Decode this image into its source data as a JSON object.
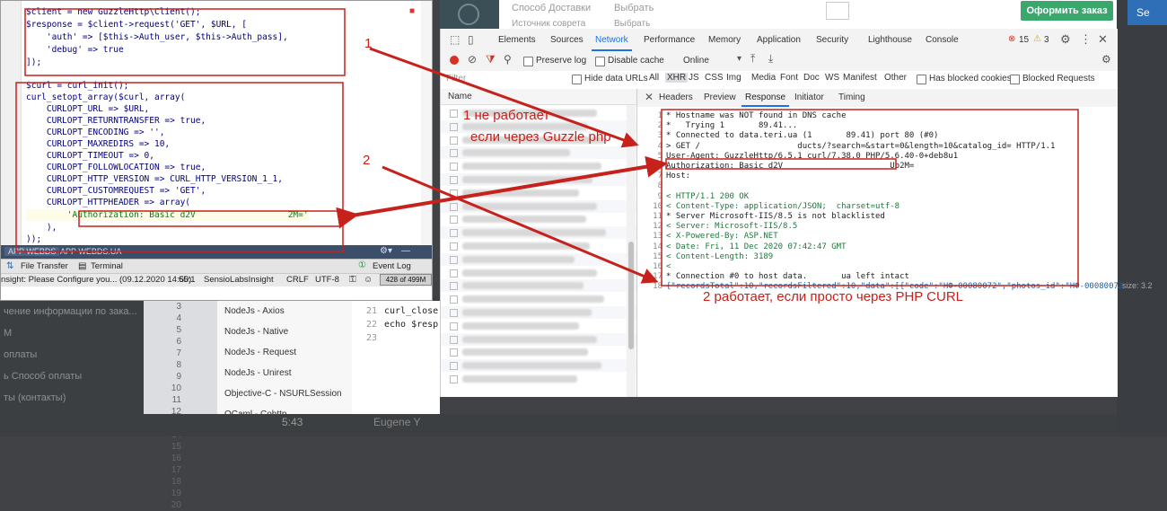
{
  "background": {
    "menu_items": [
      "чение информации по зака...",
      "M",
      "оплаты",
      "ь Способ оплаты",
      "ты (контакты)"
    ],
    "gutter_numbers": [
      "3",
      "4",
      "5",
      "6",
      "7",
      "8",
      "9",
      "10",
      "11",
      "12",
      "13",
      "14",
      "15",
      "16",
      "17",
      "18",
      "19",
      "20"
    ],
    "list_items": [
      "NodeJs - Axios",
      "NodeJs - Native",
      "NodeJs - Request",
      "NodeJs - Unirest",
      "Objective-C - NSURLSession",
      "OCaml - Cohttp"
    ],
    "code_lines": [
      {
        "num": "21",
        "text": "curl_close"
      },
      {
        "num": "22",
        "text": "echo $resp"
      },
      {
        "num": "23",
        "text": ""
      }
    ],
    "bottom_left": "5:43",
    "bottom_name": "Eugene Y",
    "right_footer": "size: 3.2"
  },
  "web": {
    "delivery": "Способ Доставки",
    "choose1": "Выбрать",
    "source": "Источник соврета",
    "choose2": "Выбрать",
    "order_button": "Оформить заказ",
    "right_button": "Se"
  },
  "devtools": {
    "tabs": [
      "Elements",
      "Sources",
      "Network",
      "Performance",
      "Memory",
      "Application",
      "Security",
      "Lighthouse",
      "Console"
    ],
    "active_tab": "Network",
    "errors": "15",
    "warnings": "3",
    "toolbar": {
      "preserve_log": "Preserve log",
      "disable_cache": "Disable cache",
      "throttle": "Online"
    },
    "filter": {
      "placeholder": "Filter",
      "hide_data_urls": "Hide data URLs",
      "types": [
        "All",
        "XHR",
        "JS",
        "CSS",
        "Img",
        "Media",
        "Font",
        "Doc",
        "WS",
        "Manifest",
        "Other"
      ],
      "active_type": "XHR",
      "blocked_cookies": "Has blocked cookies",
      "blocked_requests": "Blocked Requests"
    },
    "name_header": "Name",
    "detail_tabs": [
      "Headers",
      "Preview",
      "Response",
      "Initiator",
      "Timing"
    ],
    "active_detail_tab": "Response",
    "response_lines": [
      {
        "num": "1",
        "text": "* Hostname was NOT found in DNS cache"
      },
      {
        "num": "2",
        "text": "*   Trying 1       89.41..."
      },
      {
        "num": "3",
        "text": "* Connected to data.teri.ua (1       89.41) port 80 (#0)"
      },
      {
        "num": "4",
        "text": "> GET /                    ducts/?search=&start=0&length=10&catalog_id= HTTP/1.1"
      },
      {
        "num": "5",
        "text": "User-Agent: GuzzleHttp/6.5.1 curl/7.38.0 PHP/5.6.40-0+deb8u1"
      },
      {
        "num": "6",
        "text": "Authorization: Basic d2V                      Ub2M="
      },
      {
        "num": "7",
        "text": "Host:"
      },
      {
        "num": "8",
        "text": ""
      },
      {
        "num": "9",
        "text": "< HTTP/1.1 200 OK"
      },
      {
        "num": "10",
        "text": "< Content-Type: application/JSON;  charset=utf-8"
      },
      {
        "num": "11",
        "text": "* Server Microsoft-IIS/8.5 is not blacklisted"
      },
      {
        "num": "12",
        "text": "< Server: Microsoft-IIS/8.5"
      },
      {
        "num": "13",
        "text": "< X-Powered-By: ASP.NET"
      },
      {
        "num": "14",
        "text": "< Date: Fri, 11 Dec 2020 07:42:47 GMT"
      },
      {
        "num": "15",
        "text": "< Content-Length: 3189"
      },
      {
        "num": "16",
        "text": "<"
      },
      {
        "num": "17",
        "text": "* Connection #0 to host data.       ua left intact"
      },
      {
        "num": "18",
        "text": "{\"recordsTotal\":10,\"recordsFiltered\":10,\"data\":[{\"code\":\"HФ-00080072\",\"photos_id\":\"HФ-00080072"
      }
    ]
  },
  "ide": {
    "code_lines": [
      "$client = new GuzzleHttp\\Client();",
      "$response = $client->request('GET', $URL, [",
      "    'auth' => [$this->Auth_user, $this->Auth_pass],",
      "    'debug' => true",
      "]);",
      "",
      "$curl = curl_init();",
      "curl_setopt_array($curl, array(",
      "    CURLOPT_URL => $URL,",
      "    CURLOPT_RETURNTRANSFER => true,",
      "    CURLOPT_ENCODING => '',",
      "    CURLOPT_MAXREDIRS => 10,",
      "    CURLOPT_TIMEOUT => 0,",
      "    CURLOPT_FOLLOWLOCATION => true,",
      "    CURLOPT_HTTP_VERSION => CURL_HTTP_VERSION_1_1,",
      "    CURLOPT_CUSTOMREQUEST => 'GET',",
      "    CURLOPT_HTTPHEADER => array(",
      "        'Authorization: Basic d2V                  2M='",
      "    ),",
      "));"
    ],
    "tabs": [
      "APP WEBDS",
      "APP WEBDS.UA"
    ],
    "bottom_tabs": {
      "file_transfer": "File Transfer",
      "terminal": "Terminal",
      "event_log": "Event Log"
    },
    "status": {
      "message": "nsight: Please Configure you... (09.12.2020 14:50)",
      "position": "65:1",
      "plugin": "SensioLabsInsight",
      "line_sep": "CRLF",
      "encoding": "UTF-8",
      "memory": "428 of 499M"
    }
  },
  "annotations": {
    "label1": "1",
    "label2": "2",
    "note1_line1": "1 не работает",
    "note1_line2": "если через Guzzle php",
    "note2": "2 работает, если просто через PHP CURL",
    "color": "#c6211b"
  }
}
